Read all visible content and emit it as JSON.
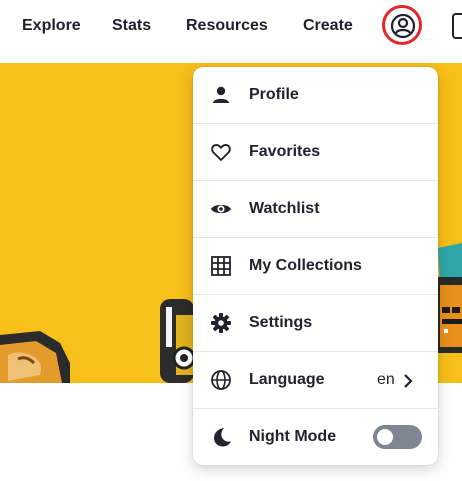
{
  "nav": {
    "links": [
      "Explore",
      "Stats",
      "Resources",
      "Create"
    ]
  },
  "menu": {
    "items": [
      {
        "label": "Profile",
        "icon": "person-icon"
      },
      {
        "label": "Favorites",
        "icon": "heart-icon"
      },
      {
        "label": "Watchlist",
        "icon": "eye-icon"
      },
      {
        "label": "My Collections",
        "icon": "grid-icon"
      },
      {
        "label": "Settings",
        "icon": "gear-icon"
      },
      {
        "label": "Language",
        "icon": "globe-icon",
        "value": "en"
      },
      {
        "label": "Night Mode",
        "icon": "moon-icon",
        "toggle_on": false
      }
    ]
  },
  "colors": {
    "banner": "#f7bf19",
    "highlight_ring": "#e0272d",
    "toggle_off": "#7e8692"
  }
}
